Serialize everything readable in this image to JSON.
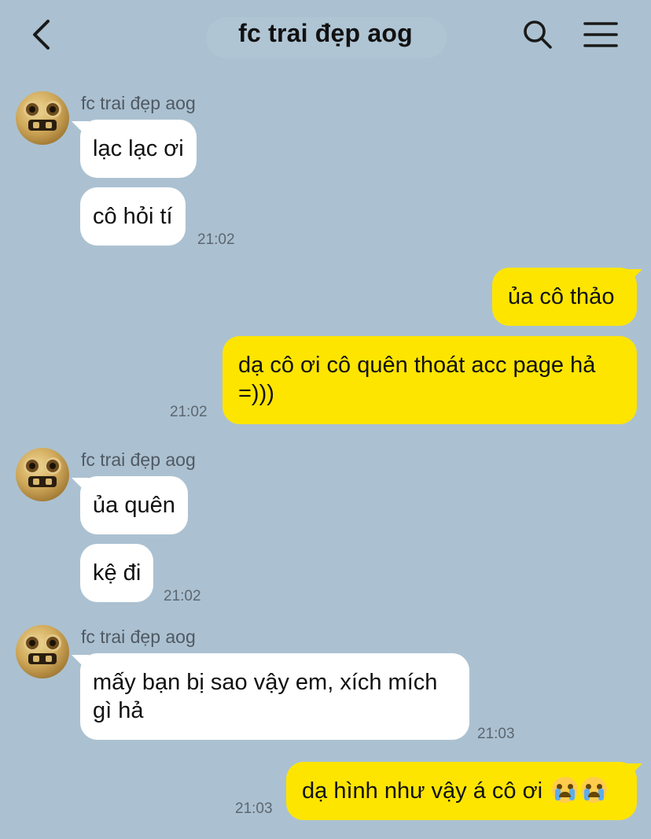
{
  "header": {
    "title": "fc trai đẹp aog",
    "icons": {
      "back": "chevron-left-icon",
      "search": "search-icon",
      "menu": "hamburger-menu-icon"
    }
  },
  "colors": {
    "background": "#abc1d1",
    "incoming_bubble": "#ffffff",
    "outgoing_bubble": "#fee500",
    "timestamp": "#5c6670",
    "sender_name": "#505963"
  },
  "messages": [
    {
      "sender": "fc trai đẹp aog",
      "text": "lạc lạc ơi"
    },
    {
      "text": "cô hỏi tí",
      "time": "21:02"
    },
    {
      "text": "ủa cô thảo"
    },
    {
      "text": "dạ cô ơi cô quên thoát acc page hả",
      "text2": "=)))",
      "time": "21:02"
    },
    {
      "sender": "fc trai đẹp aog",
      "text": "ủa quên"
    },
    {
      "text": "kệ đi",
      "time": "21:02"
    },
    {
      "sender": "fc trai đẹp aog",
      "text": "mấy bạn bị sao vậy em, xích mích",
      "text2": "gì hả",
      "time": "21:03"
    },
    {
      "text": "dạ hình như vậy á cô ơi",
      "emoji": "loudly-crying-face-emoji",
      "time": "21:03"
    }
  ]
}
